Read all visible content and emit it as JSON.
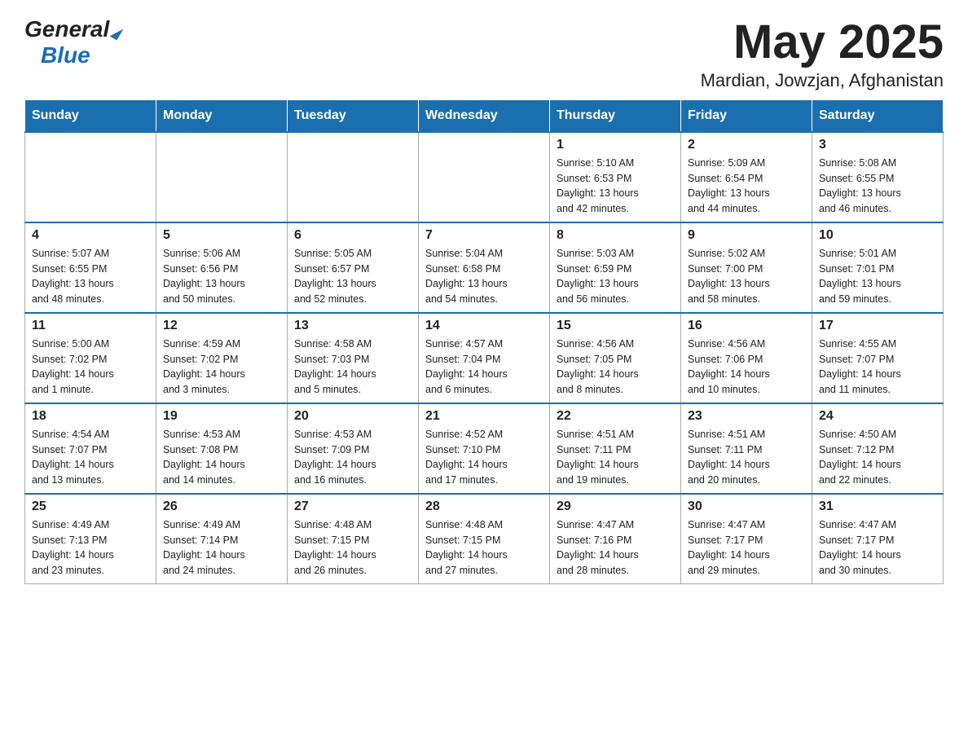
{
  "header": {
    "logo_general": "General",
    "logo_triangle": "▶",
    "logo_blue": "Blue",
    "month_title": "May 2025",
    "location": "Mardian, Jowzjan, Afghanistan"
  },
  "weekdays": [
    "Sunday",
    "Monday",
    "Tuesday",
    "Wednesday",
    "Thursday",
    "Friday",
    "Saturday"
  ],
  "weeks": [
    {
      "days": [
        {
          "number": "",
          "info": ""
        },
        {
          "number": "",
          "info": ""
        },
        {
          "number": "",
          "info": ""
        },
        {
          "number": "",
          "info": ""
        },
        {
          "number": "1",
          "info": "Sunrise: 5:10 AM\nSunset: 6:53 PM\nDaylight: 13 hours\nand 42 minutes."
        },
        {
          "number": "2",
          "info": "Sunrise: 5:09 AM\nSunset: 6:54 PM\nDaylight: 13 hours\nand 44 minutes."
        },
        {
          "number": "3",
          "info": "Sunrise: 5:08 AM\nSunset: 6:55 PM\nDaylight: 13 hours\nand 46 minutes."
        }
      ]
    },
    {
      "days": [
        {
          "number": "4",
          "info": "Sunrise: 5:07 AM\nSunset: 6:55 PM\nDaylight: 13 hours\nand 48 minutes."
        },
        {
          "number": "5",
          "info": "Sunrise: 5:06 AM\nSunset: 6:56 PM\nDaylight: 13 hours\nand 50 minutes."
        },
        {
          "number": "6",
          "info": "Sunrise: 5:05 AM\nSunset: 6:57 PM\nDaylight: 13 hours\nand 52 minutes."
        },
        {
          "number": "7",
          "info": "Sunrise: 5:04 AM\nSunset: 6:58 PM\nDaylight: 13 hours\nand 54 minutes."
        },
        {
          "number": "8",
          "info": "Sunrise: 5:03 AM\nSunset: 6:59 PM\nDaylight: 13 hours\nand 56 minutes."
        },
        {
          "number": "9",
          "info": "Sunrise: 5:02 AM\nSunset: 7:00 PM\nDaylight: 13 hours\nand 58 minutes."
        },
        {
          "number": "10",
          "info": "Sunrise: 5:01 AM\nSunset: 7:01 PM\nDaylight: 13 hours\nand 59 minutes."
        }
      ]
    },
    {
      "days": [
        {
          "number": "11",
          "info": "Sunrise: 5:00 AM\nSunset: 7:02 PM\nDaylight: 14 hours\nand 1 minute."
        },
        {
          "number": "12",
          "info": "Sunrise: 4:59 AM\nSunset: 7:02 PM\nDaylight: 14 hours\nand 3 minutes."
        },
        {
          "number": "13",
          "info": "Sunrise: 4:58 AM\nSunset: 7:03 PM\nDaylight: 14 hours\nand 5 minutes."
        },
        {
          "number": "14",
          "info": "Sunrise: 4:57 AM\nSunset: 7:04 PM\nDaylight: 14 hours\nand 6 minutes."
        },
        {
          "number": "15",
          "info": "Sunrise: 4:56 AM\nSunset: 7:05 PM\nDaylight: 14 hours\nand 8 minutes."
        },
        {
          "number": "16",
          "info": "Sunrise: 4:56 AM\nSunset: 7:06 PM\nDaylight: 14 hours\nand 10 minutes."
        },
        {
          "number": "17",
          "info": "Sunrise: 4:55 AM\nSunset: 7:07 PM\nDaylight: 14 hours\nand 11 minutes."
        }
      ]
    },
    {
      "days": [
        {
          "number": "18",
          "info": "Sunrise: 4:54 AM\nSunset: 7:07 PM\nDaylight: 14 hours\nand 13 minutes."
        },
        {
          "number": "19",
          "info": "Sunrise: 4:53 AM\nSunset: 7:08 PM\nDaylight: 14 hours\nand 14 minutes."
        },
        {
          "number": "20",
          "info": "Sunrise: 4:53 AM\nSunset: 7:09 PM\nDaylight: 14 hours\nand 16 minutes."
        },
        {
          "number": "21",
          "info": "Sunrise: 4:52 AM\nSunset: 7:10 PM\nDaylight: 14 hours\nand 17 minutes."
        },
        {
          "number": "22",
          "info": "Sunrise: 4:51 AM\nSunset: 7:11 PM\nDaylight: 14 hours\nand 19 minutes."
        },
        {
          "number": "23",
          "info": "Sunrise: 4:51 AM\nSunset: 7:11 PM\nDaylight: 14 hours\nand 20 minutes."
        },
        {
          "number": "24",
          "info": "Sunrise: 4:50 AM\nSunset: 7:12 PM\nDaylight: 14 hours\nand 22 minutes."
        }
      ]
    },
    {
      "days": [
        {
          "number": "25",
          "info": "Sunrise: 4:49 AM\nSunset: 7:13 PM\nDaylight: 14 hours\nand 23 minutes."
        },
        {
          "number": "26",
          "info": "Sunrise: 4:49 AM\nSunset: 7:14 PM\nDaylight: 14 hours\nand 24 minutes."
        },
        {
          "number": "27",
          "info": "Sunrise: 4:48 AM\nSunset: 7:15 PM\nDaylight: 14 hours\nand 26 minutes."
        },
        {
          "number": "28",
          "info": "Sunrise: 4:48 AM\nSunset: 7:15 PM\nDaylight: 14 hours\nand 27 minutes."
        },
        {
          "number": "29",
          "info": "Sunrise: 4:47 AM\nSunset: 7:16 PM\nDaylight: 14 hours\nand 28 minutes."
        },
        {
          "number": "30",
          "info": "Sunrise: 4:47 AM\nSunset: 7:17 PM\nDaylight: 14 hours\nand 29 minutes."
        },
        {
          "number": "31",
          "info": "Sunrise: 4:47 AM\nSunset: 7:17 PM\nDaylight: 14 hours\nand 30 minutes."
        }
      ]
    }
  ]
}
